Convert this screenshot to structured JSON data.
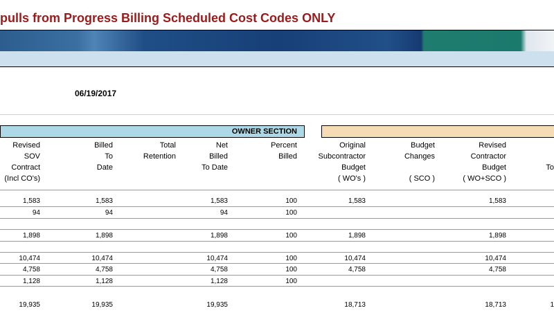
{
  "title": "pulls from Progress Billing Scheduled Cost Codes ONLY",
  "date": "06/19/2017",
  "owner_section_label": "OWNER SECTION",
  "headers": [
    {
      "lines": [
        "Revised",
        "SOV",
        "Contract",
        "(Incl CO's)"
      ]
    },
    {
      "lines": [
        "Billed",
        "To",
        "Date",
        ""
      ]
    },
    {
      "lines": [
        "Total",
        "Retention",
        "",
        ""
      ]
    },
    {
      "lines": [
        "Net",
        "Billed",
        "To Date",
        ""
      ]
    },
    {
      "lines": [
        "Percent",
        "Billed",
        "",
        ""
      ]
    },
    {
      "lines": [
        "Original",
        "Subcontractor",
        "Budget",
        "( WO's )"
      ]
    },
    {
      "lines": [
        "Budget",
        "Changes",
        "",
        "( SCO )"
      ]
    },
    {
      "lines": [
        "Revised",
        "Contractor",
        "Budget",
        "( WO+SCO )"
      ]
    },
    {
      "lines": [
        "",
        "",
        "To",
        ""
      ]
    }
  ],
  "rows": [
    [
      "1,583",
      "1,583",
      "",
      "1,583",
      "100",
      "1,583",
      "",
      "1,583",
      ""
    ],
    [
      "94",
      "94",
      "",
      "94",
      "100",
      "",
      "",
      "",
      ""
    ],
    [
      "1,898",
      "1,898",
      "",
      "1,898",
      "100",
      "1,898",
      "",
      "1,898",
      ""
    ],
    [
      "10,474",
      "10,474",
      "",
      "10,474",
      "100",
      "10,474",
      "",
      "10,474",
      ""
    ],
    [
      "4,758",
      "4,758",
      "",
      "4,758",
      "100",
      "4,758",
      "",
      "4,758",
      ""
    ],
    [
      "1,128",
      "1,128",
      "",
      "1,128",
      "100",
      "",
      "",
      "",
      ""
    ],
    [
      "19,935",
      "19,935",
      "",
      "19,935",
      "",
      "18,713",
      "",
      "18,713",
      "1"
    ]
  ]
}
